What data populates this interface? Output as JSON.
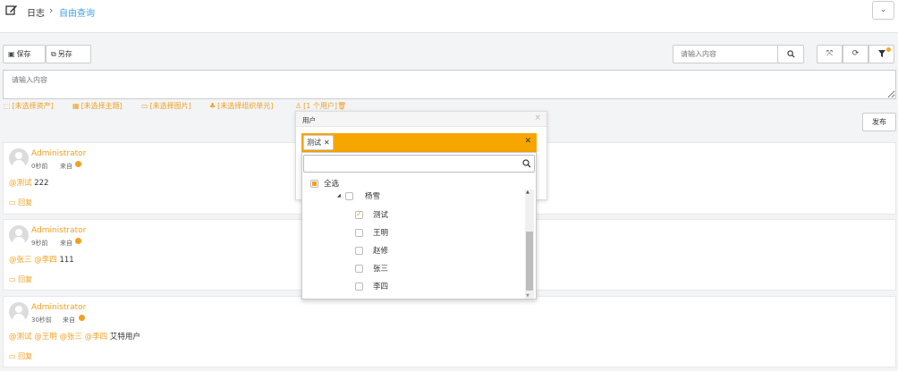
{
  "header": {
    "breadcrumb_home": "日志",
    "breadcrumb_sep": "›",
    "breadcrumb_current": "自由查询",
    "dropdown_glyph": "⌄"
  },
  "toolbar": {
    "save_label": "保存",
    "save_as_label": "另存",
    "search_placeholder": "请输入内容"
  },
  "composer": {
    "placeholder": "请输入内容",
    "publish_label": "发布"
  },
  "selection": {
    "asset": "[未选择资产]",
    "topic": "[未选择主题]",
    "image": "[未选择图片]",
    "org": "[未选择组织单元]",
    "users": "[1 个用户]"
  },
  "posts": [
    {
      "user": "Administrator",
      "time": "0秒前",
      "from": "来自",
      "mentions": [
        "@测试"
      ],
      "text": "222",
      "reply": "回复"
    },
    {
      "user": "Administrator",
      "time": "9秒前",
      "from": "来自",
      "mentions": [
        "@张三",
        "@李四"
      ],
      "text": "111",
      "reply": "回复"
    },
    {
      "user": "Administrator",
      "time": "30秒前",
      "from": "来自",
      "mentions": [
        "@测试",
        "@王明",
        "@张三",
        "@李四"
      ],
      "text": "艾特用户",
      "reply": "回复"
    }
  ],
  "user_popup": {
    "title": "用户",
    "selected_tag": "测试",
    "tree": {
      "select_all": "全选",
      "group": "杨雪",
      "members": [
        {
          "name": "测试",
          "checked": true
        },
        {
          "name": "王明",
          "checked": false
        },
        {
          "name": "赵修",
          "checked": false
        },
        {
          "name": "张三",
          "checked": false
        },
        {
          "name": "李四",
          "checked": false
        }
      ]
    }
  }
}
